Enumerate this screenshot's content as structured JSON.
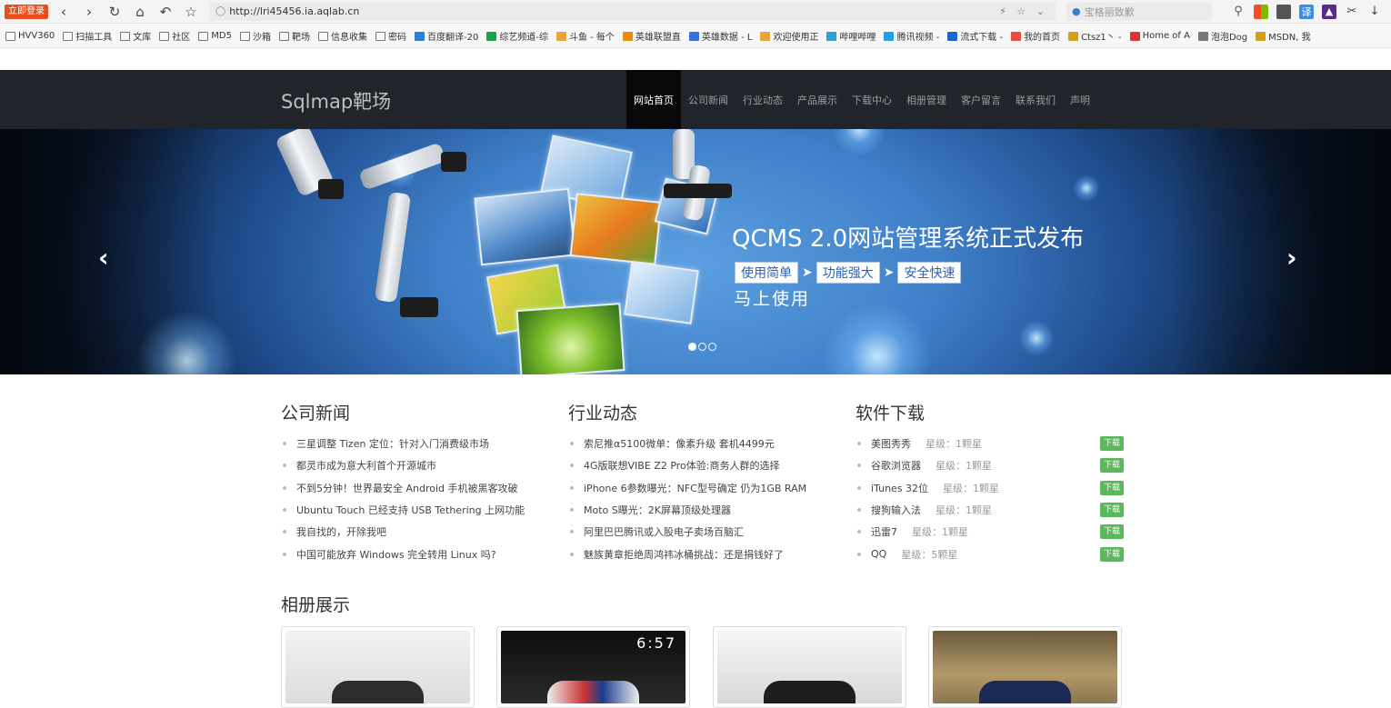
{
  "browser": {
    "login_badge": "立即登录",
    "url": "http://lri45456.ia.aqlab.cn",
    "search_placeholder": "宝格丽致歉",
    "bookmarks": [
      "HVV360",
      "扫描工具",
      "文库",
      "社区",
      "MD5",
      "沙箱",
      "靶场",
      "信息收集",
      "密码",
      "百度翻译-20",
      "综艺频道-综",
      "斗鱼 - 每个",
      "英雄联盟直",
      "英雄数据 - L",
      "欢迎使用正",
      "哔哩哔哩",
      "腾讯视频 -",
      "流式下载 -",
      "我的首页",
      "Ctsz1丶 -",
      "Home of A",
      "泡泡Dog",
      "MSDN, 我"
    ]
  },
  "site": {
    "brand": "Sqlmap靶场",
    "menu": [
      "网站首页",
      "公司新闻",
      "行业动态",
      "产品展示",
      "下载中心",
      "相册管理",
      "客户留言",
      "联系我们",
      "声明"
    ]
  },
  "carousel": {
    "title": "QCMS 2.0网站管理系统正式发布",
    "steps": [
      "使用简单",
      "功能强大",
      "安全快速"
    ],
    "subtitle": "马上使用",
    "prev": "‹",
    "next": "›"
  },
  "news": {
    "title": "公司新闻",
    "items": [
      "三星调整 Tizen 定位：针对入门消费级市场",
      "都灵市成为意大利首个开源城市",
      "不到5分钟！世界最安全 Android 手机被黑客攻破",
      "Ubuntu Touch 已经支持 USB Tethering 上网功能",
      "我自找的，开除我吧",
      "中国可能放弃 Windows 完全转用 Linux 吗?"
    ]
  },
  "industry": {
    "title": "行业动态",
    "items": [
      "索尼推α5100微单：像素升级 套机4499元",
      "4G版联想VIBE Z2 Pro体验:商务人群的选择",
      "iPhone 6参数曝光：NFC型号确定 仍为1GB RAM",
      "Moto S曝光：2K屏幕顶级处理器",
      "阿里巴巴腾讯或入股电子卖场百脑汇",
      "魅族黄章拒绝周鸿祎冰桶挑战：还是捐钱好了"
    ]
  },
  "downloads": {
    "title": "软件下载",
    "button": "下载",
    "items": [
      {
        "name": "美图秀秀",
        "rating": "星级：1颗星"
      },
      {
        "name": "谷歌浏览器",
        "rating": "星级：1颗星"
      },
      {
        "name": "iTunes 32位",
        "rating": "星级：1颗星"
      },
      {
        "name": "搜狗输入法",
        "rating": "星级：1颗星"
      },
      {
        "name": "迅雷7",
        "rating": "星级：1颗星"
      },
      {
        "name": "QQ",
        "rating": "星级：5颗星"
      }
    ]
  },
  "album": {
    "title": "相册展示",
    "clock": "6:57"
  }
}
